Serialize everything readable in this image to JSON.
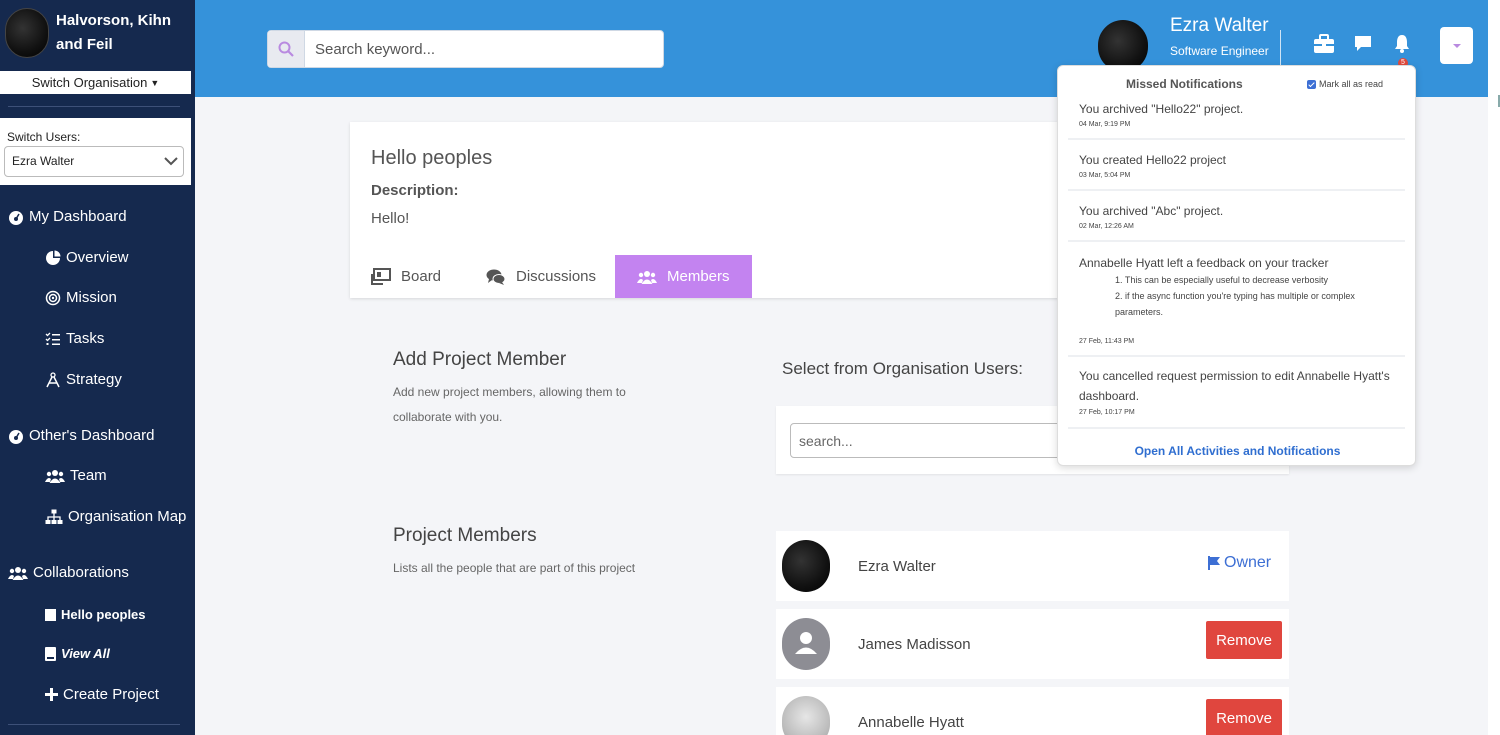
{
  "sidebar": {
    "org_name": "Halvorson, Kihn and Feil",
    "switch_org_label": "Switch Organisation",
    "switch_users_label": "Switch Users:",
    "selected_user": "Ezra Walter",
    "my_dashboard": "My Dashboard",
    "overview": "Overview",
    "mission": "Mission",
    "tasks": "Tasks",
    "strategy": "Strategy",
    "others_dashboard": "Other's Dashboard",
    "team": "Team",
    "organisation_map": "Organisation Map",
    "collaborations": "Collaborations",
    "hello_peoples": "Hello peoples",
    "view_all": "View All",
    "create_project": "Create Project"
  },
  "header": {
    "search_placeholder": "Search keyword...",
    "user_name": "Ezra Walter",
    "user_role": "Software Engineer",
    "notification_count": "5"
  },
  "project": {
    "title": "Hello peoples",
    "description_label": "Description:",
    "description": "Hello!",
    "tabs": [
      "Board",
      "Discussions",
      "Members"
    ],
    "active_tab": "Members"
  },
  "add_member": {
    "title": "Add Project Member",
    "subtitle": "Add new project members, allowing them to collaborate with you.",
    "select_title": "Select from Organisation Users:",
    "search_placeholder": "search..."
  },
  "project_members": {
    "title": "Project Members",
    "subtitle": "Lists all the people that are part of this project",
    "owner_label": "Owner",
    "remove_label": "Remove",
    "members": [
      {
        "name": "Ezra Walter",
        "role": "owner"
      },
      {
        "name": "James Madisson",
        "role": "member"
      },
      {
        "name": "Annabelle Hyatt",
        "role": "member"
      }
    ]
  },
  "notifications": {
    "title": "Missed Notifications",
    "mark_all": "Mark all as read",
    "items": [
      {
        "text": "You archived \"Hello22\" project.",
        "time": "04 Mar, 9:19 PM"
      },
      {
        "text": "You created Hello22 project",
        "time": "03 Mar, 5:04 PM"
      },
      {
        "text": "You archived \"Abc\" project.",
        "time": "02 Mar, 12:26 AM"
      },
      {
        "text": "Annabelle Hyatt left a feedback on your tracker",
        "sub1": "1. This can be especially useful to decrease verbosity",
        "sub2": "2. if the async function you're typing has multiple or complex parameters.",
        "time": "27 Feb, 11:43 PM"
      },
      {
        "text": "You cancelled request permission to edit Annabelle Hyatt's dashboard.",
        "time": "27 Feb, 10:17 PM"
      }
    ],
    "open_all": "Open All Activities and Notifications"
  },
  "colors": {
    "sidebar_bg": "#15294e",
    "header_bg": "#3592da",
    "active_tab": "#c383f0",
    "remove_button": "#e0463e",
    "owner_link": "#3d6fd4"
  }
}
